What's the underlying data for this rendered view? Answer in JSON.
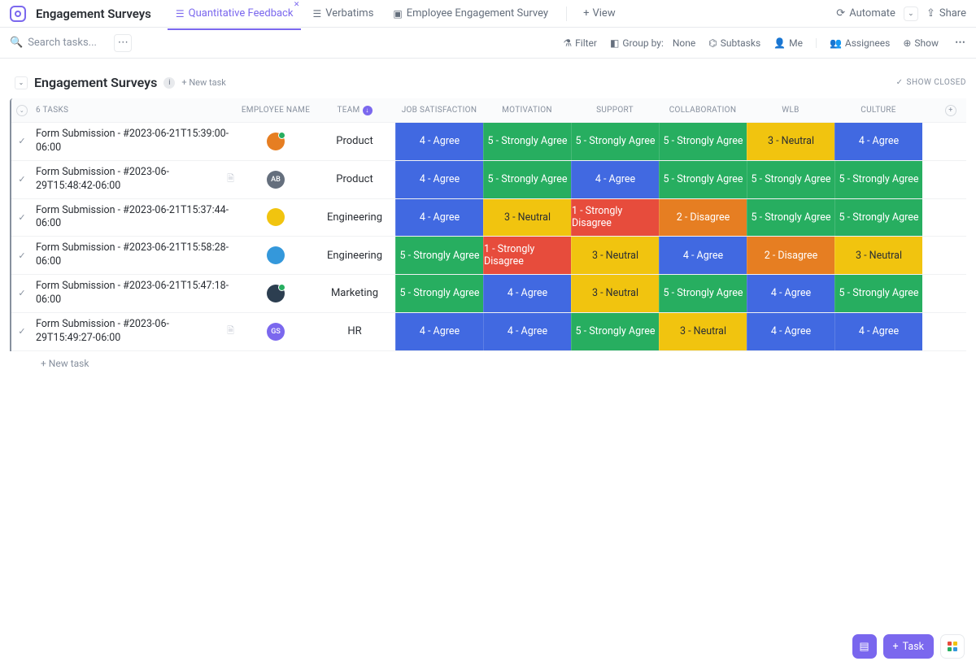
{
  "header": {
    "title": "Engagement Surveys",
    "tabs": [
      {
        "label": "Quantitative Feedback",
        "active": true,
        "closable": true
      },
      {
        "label": "Verbatims",
        "active": false
      },
      {
        "label": "Employee Engagement Survey",
        "active": false
      }
    ],
    "view_label": "View",
    "automate_label": "Automate",
    "share_label": "Share"
  },
  "toolbar": {
    "search_placeholder": "Search tasks...",
    "filter_label": "Filter",
    "group_by_label": "Group by:",
    "group_by_value": "None",
    "subtasks_label": "Subtasks",
    "me_label": "Me",
    "assignees_label": "Assignees",
    "show_label": "Show"
  },
  "group": {
    "title": "Engagement Surveys",
    "new_task_label": "+ New task",
    "show_closed_label": "SHOW CLOSED",
    "task_count_label": "6 TASKS"
  },
  "columns": {
    "employee_name": "EMPLOYEE NAME",
    "team": "TEAM",
    "job_satisfaction": "JOB SATISFACTION",
    "motivation": "MOTIVATION",
    "support": "SUPPORT",
    "collaboration": "COLLABORATION",
    "wlb": "WLB",
    "culture": "CULTURE"
  },
  "scale_colors": {
    "1": "c-red",
    "2": "c-orange",
    "3": "c-yellow",
    "4": "c-blue",
    "5": "c-green"
  },
  "rows": [
    {
      "name": "Form Submission - #2023-06-21T15:39:00-06:00",
      "has_doc": false,
      "avatar": {
        "type": "img",
        "bg": "#e67e22",
        "initials": "",
        "online": true
      },
      "team": "Product",
      "metrics": [
        "4 - Agree",
        "5 - Strongly Agree",
        "5 - Strongly Agree",
        "5 - Strongly Agree",
        "3 - Neutral",
        "4 - Agree"
      ]
    },
    {
      "name": "Form Submission - #2023-06-29T15:48:42-06:00",
      "has_doc": true,
      "avatar": {
        "type": "initials",
        "bg": "#656f7d",
        "initials": "AB",
        "online": false
      },
      "team": "Product",
      "metrics": [
        "4 - Agree",
        "5 - Strongly Agree",
        "4 - Agree",
        "5 - Strongly Agree",
        "5 - Strongly Agree",
        "5 - Strongly Agree"
      ]
    },
    {
      "name": "Form Submission - #2023-06-21T15:37:44-06:00",
      "has_doc": false,
      "avatar": {
        "type": "img",
        "bg": "#f1c40f",
        "initials": "",
        "online": false
      },
      "team": "Engineering",
      "metrics": [
        "4 - Agree",
        "3 - Neutral",
        "1 - Strongly Disagree",
        "2 - Disagree",
        "5 - Strongly Agree",
        "5 - Strongly Agree"
      ]
    },
    {
      "name": "Form Submission - #2023-06-21T15:58:28-06:00",
      "has_doc": false,
      "avatar": {
        "type": "img",
        "bg": "#3498db",
        "initials": "",
        "online": false
      },
      "team": "Engineering",
      "metrics": [
        "5 - Strongly Agree",
        "1 - Strongly Disagree",
        "3 - Neutral",
        "4 - Agree",
        "2 - Disagree",
        "3 - Neutral"
      ]
    },
    {
      "name": "Form Submission - #2023-06-21T15:47:18-06:00",
      "has_doc": false,
      "avatar": {
        "type": "img",
        "bg": "#2c3e50",
        "initials": "",
        "online": true
      },
      "team": "Marketing",
      "metrics": [
        "5 - Strongly Agree",
        "4 - Agree",
        "3 - Neutral",
        "5 - Strongly Agree",
        "4 - Agree",
        "5 - Strongly Agree"
      ]
    },
    {
      "name": "Form Submission - #2023-06-29T15:49:27-06:00",
      "has_doc": true,
      "avatar": {
        "type": "initials",
        "bg": "#7b68ee",
        "initials": "GS",
        "online": false
      },
      "team": "HR",
      "metrics": [
        "4 - Agree",
        "4 - Agree",
        "5 - Strongly Agree",
        "3 - Neutral",
        "4 - Agree",
        "4 - Agree"
      ]
    }
  ],
  "footer": {
    "new_task_label": "+ New task",
    "task_btn_label": "Task"
  }
}
